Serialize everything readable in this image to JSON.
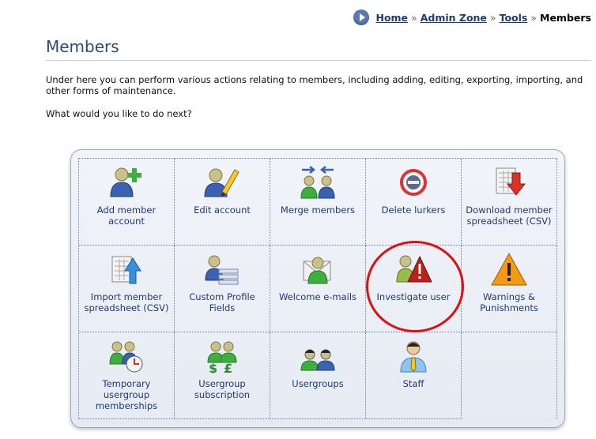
{
  "breadcrumb": {
    "home": "Home",
    "admin_zone": "Admin Zone",
    "tools": "Tools",
    "current": "Members",
    "separator": "»"
  },
  "page": {
    "title": "Members",
    "intro": "Under here you can perform various actions relating to members, including adding, editing, exporting, importing, and other forms of maintenance.",
    "question": "What would you like to do next?"
  },
  "actions": [
    {
      "label": "Add member account",
      "icon": "add-member-icon"
    },
    {
      "label": "Edit account",
      "icon": "edit-account-icon"
    },
    {
      "label": "Merge members",
      "icon": "merge-members-icon"
    },
    {
      "label": "Delete lurkers",
      "icon": "delete-lurkers-icon"
    },
    {
      "label": "Download member spreadsheet (CSV)",
      "icon": "download-spreadsheet-icon"
    },
    {
      "label": "Import member spreadsheet (CSV)",
      "icon": "import-spreadsheet-icon"
    },
    {
      "label": "Custom Profile Fields",
      "icon": "custom-profile-fields-icon"
    },
    {
      "label": "Welcome e-mails",
      "icon": "welcome-emails-icon"
    },
    {
      "label": "Investigate user",
      "icon": "investigate-user-icon"
    },
    {
      "label": "Warnings & Punishments",
      "icon": "warning-icon"
    },
    {
      "label": "Temporary usergroup memberships",
      "icon": "temporary-usergroup-icon"
    },
    {
      "label": "Usergroup subscription",
      "icon": "usergroup-subscription-icon"
    },
    {
      "label": "Usergroups",
      "icon": "usergroups-icon"
    },
    {
      "label": "Staff",
      "icon": "staff-icon"
    }
  ],
  "colors": {
    "link": "#1f3a70",
    "title": "#2a4a7a",
    "highlight": "#e01010"
  }
}
